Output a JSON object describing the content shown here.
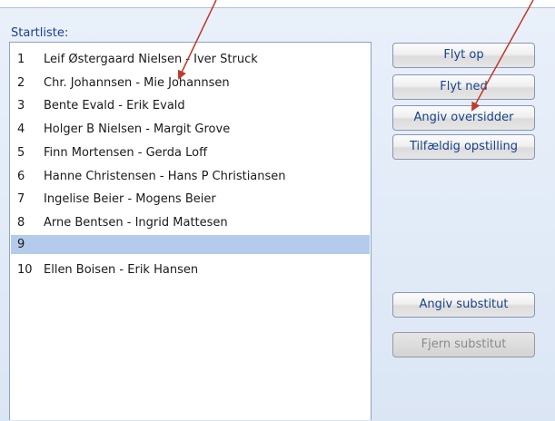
{
  "panel": {
    "title": "Startliste:"
  },
  "list": {
    "rows": [
      {
        "num": "1",
        "name": "Leif Østergaard Nielsen - Iver Struck"
      },
      {
        "num": "2",
        "name": "Chr. Johannsen - Mie Johannsen"
      },
      {
        "num": "3",
        "name": "Bente Evald - Erik Evald"
      },
      {
        "num": "4",
        "name": "Holger B Nielsen - Margit Grove"
      },
      {
        "num": "5",
        "name": "Finn Mortensen - Gerda Loff"
      },
      {
        "num": "6",
        "name": "Hanne Christensen - Hans P Christiansen"
      },
      {
        "num": "7",
        "name": "Ingelise Beier - Mogens Beier"
      },
      {
        "num": "8",
        "name": "Arne Bentsen - Ingrid Mattesen"
      },
      {
        "num": "9",
        "name": ""
      },
      {
        "num": "10",
        "name": "Ellen Boisen - Erik Hansen"
      }
    ],
    "selected_row": "9",
    "selection_color": "#b4cbeb"
  },
  "buttons": {
    "move_up": "Flyt op",
    "move_down": "Flyt ned",
    "set_sitout": "Angiv oversidder",
    "random": "Tilfældig opstilling",
    "set_substitute": "Angiv substitut",
    "remove_substitute": "Fjern substitut"
  },
  "annotations": {
    "arrow_color": "#c0392b"
  }
}
